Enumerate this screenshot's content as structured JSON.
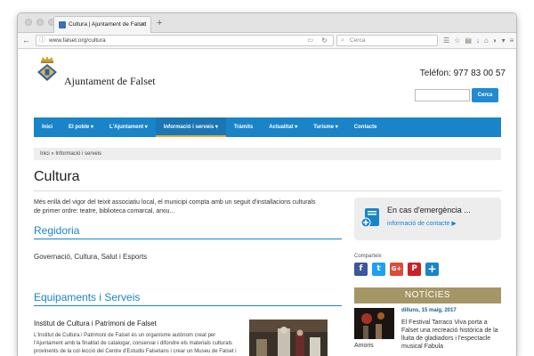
{
  "browser": {
    "tab_title": "Cultura | Ajuntament de Falset",
    "url": "www.falset.org/cultura",
    "search_placeholder": "Cerca"
  },
  "header": {
    "site_name": "Ajuntament de Falset",
    "phone": "Teléfon: 977 83 00 57",
    "search_button": "Cerca"
  },
  "nav": {
    "items": [
      {
        "label": "Inici"
      },
      {
        "label": "El poble ▾"
      },
      {
        "label": "L'Ajuntament ▾"
      },
      {
        "label": "Informació i serveis ▾"
      },
      {
        "label": "Tràmits"
      },
      {
        "label": "Actualitat ▾"
      },
      {
        "label": "Turisme ▾"
      },
      {
        "label": "Contacte"
      }
    ]
  },
  "breadcrumb": "Inici » Informació i serveis",
  "page": {
    "title": "Cultura",
    "intro": "Més enllà del vigor del teixit associatiu local, el municipi compta amb un seguit d'installacions culturals de primer ordre: teatre, biblioteca comarcal, arxiu...",
    "regidoria_heading": "Regidoria",
    "regidoria_text": "Governació, Cultura, Salut i Esports",
    "equipaments_heading": "Equipaments i Serveis",
    "institut_title": "Institut de Cultura i Patrimoni de Falset",
    "institut_text": "L'Institut de Cultura i Patrimoni de Falset és un organisme autònom creat per l'Ajuntament amb la finalitat de catalogar, conservar i difondre els materials culturals provinents de la col·lecció del Centre d'Estudis Falsetans i crear un Museu de Falset i Comarca."
  },
  "sidebar": {
    "emergency_title": "En cas d'emergència ...",
    "emergency_link": "informació de contacte ▶",
    "share_label": "Comparteix",
    "share_buttons": [
      {
        "label": "f",
        "color": "#3b5998"
      },
      {
        "label": "t",
        "color": "#1da1f2"
      },
      {
        "label": "G+",
        "color": "#dd4b39"
      },
      {
        "label": "P",
        "color": "#cb2027"
      },
      {
        "label": "+",
        "color": "#1a84c9"
      }
    ],
    "news_heading": "NOTÍCIES",
    "news_date": "dilluns, 15 maig, 2017",
    "news_text": "El Festival Tarraco Viva porta a Falset una recreació històrica de la lluita de gladiadors i l'espectacle musical Fabula",
    "news_text_cont": "Amoris"
  },
  "colors": {
    "accent": "#1a84c9",
    "news_header": "#a49665",
    "breadcrumb_bg": "#eeeeee"
  }
}
